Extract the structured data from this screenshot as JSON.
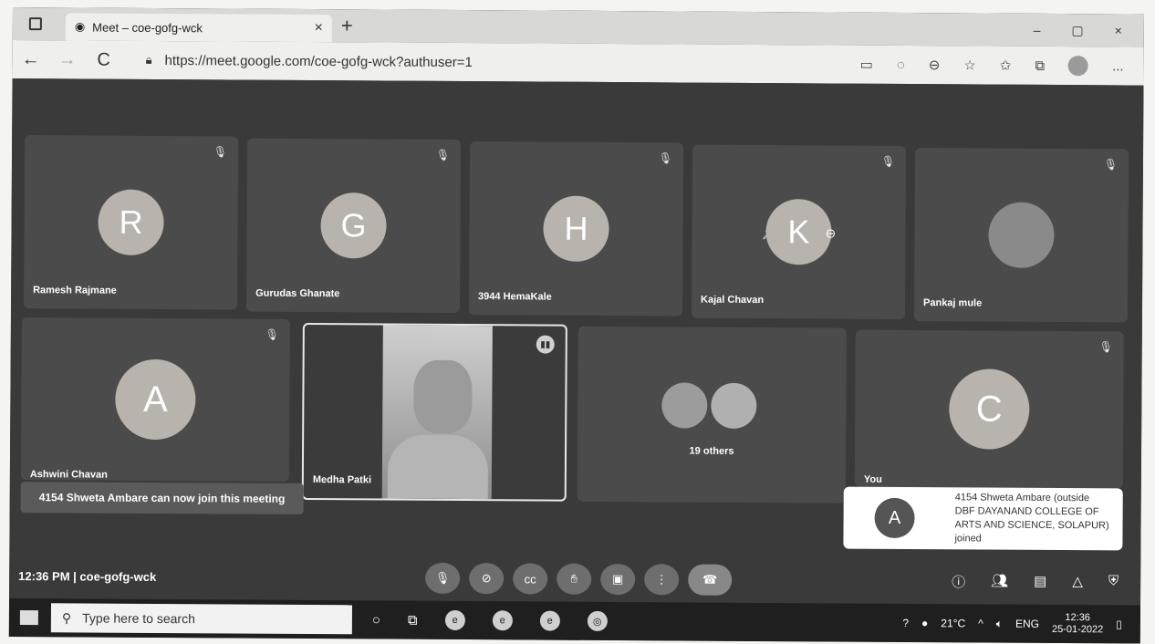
{
  "browser": {
    "tab_title": "Meet – coe-gofg-wck",
    "tab_close": "×",
    "new_tab": "+",
    "win_min": "–",
    "win_max": "▢",
    "win_close": "×",
    "back": "←",
    "forward": "→",
    "refresh": "C",
    "url": "https://meet.google.com/coe-gofg-wck?authuser=1",
    "more": "..."
  },
  "tiles": [
    {
      "initial": "R",
      "name": "Ramesh Rajmane"
    },
    {
      "initial": "G",
      "name": "Gurudas Ghanate"
    },
    {
      "initial": "H",
      "name": "3944 HemaKale"
    },
    {
      "initial": "K",
      "name": "Kajal Chavan"
    },
    {
      "initial": "",
      "name": "Pankaj mule"
    },
    {
      "initial": "A",
      "name": "Ashwini Chavan"
    },
    {
      "initial": "",
      "name": "Medha Patki"
    },
    {
      "initial": "",
      "name": "19 others"
    },
    {
      "initial": "C",
      "name": "You"
    }
  ],
  "toast": "4154 Shweta Ambare can now join this meeting",
  "joined": {
    "initial": "A",
    "text": "4154 Shweta Ambare (outside DBF DAYANAND COLLEGE OF ARTS AND SCIENCE, SOLAPUR) joined"
  },
  "meeting": {
    "time": "12:36 PM",
    "code": "coe-gofg-wck"
  },
  "taskbar": {
    "search_placeholder": "Type here to search",
    "temperature": "21°C",
    "lang": "ENG",
    "time": "12:36",
    "date": "25-01-2022"
  }
}
